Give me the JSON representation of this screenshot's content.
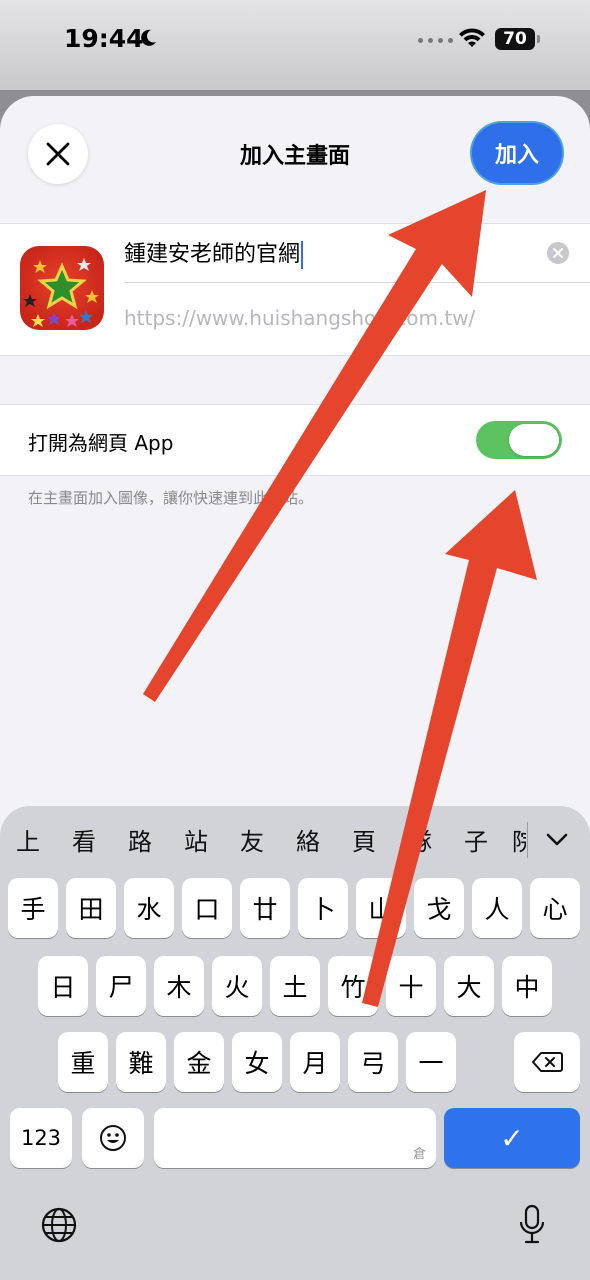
{
  "status_bar": {
    "time": "19:44",
    "battery": "70"
  },
  "sheet": {
    "title": "加入主畫面",
    "add_label": "加入",
    "name_value": "鍾建安老師的官網",
    "url": "https://www.huishangshou.com.tw/",
    "toggle_label": "打開為網頁 App",
    "toggle_on": true,
    "footnote": "在主畫面加入圖像，讓你快速連到此網站。"
  },
  "keyboard": {
    "suggestions": [
      "上",
      "看",
      "路",
      "站",
      "友",
      "絡",
      "頁",
      "隊",
      "子",
      "院"
    ],
    "row1": [
      "手",
      "田",
      "水",
      "口",
      "廿",
      "卜",
      "山",
      "戈",
      "人",
      "心"
    ],
    "row2": [
      "日",
      "尸",
      "木",
      "火",
      "土",
      "竹",
      "十",
      "大",
      "中"
    ],
    "row3": [
      "重",
      "難",
      "金",
      "女",
      "月",
      "弓",
      "一"
    ],
    "numbers_label": "123",
    "space_hint": "倉",
    "done_label": "✓"
  },
  "colors": {
    "accent": "#2f6fe9",
    "toggle": "#5dc360",
    "arrow": "#e4452c"
  }
}
